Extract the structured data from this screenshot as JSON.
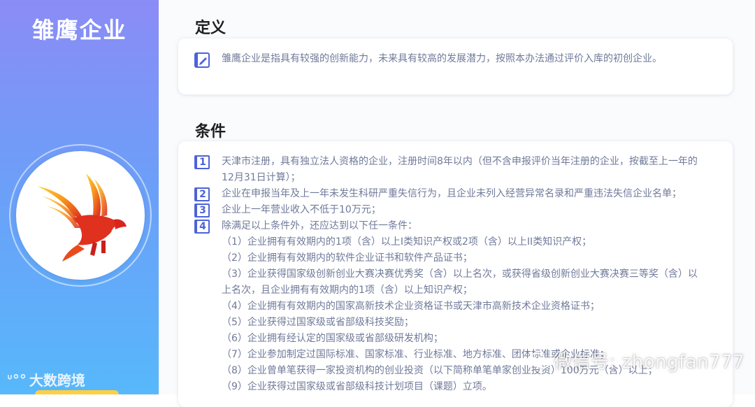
{
  "sidebar": {
    "title": "雏鹰企业",
    "brand_text": "大数跨境",
    "logo_icon": "eagle-logo-icon"
  },
  "definition": {
    "heading": "定义",
    "text": "雏鹰企业是指具有较强的创新能力，未来具有较高的发展潜力，按照本办法通过评价入库的初创企业。"
  },
  "conditions": {
    "heading": "条件",
    "items": [
      {
        "num": "1",
        "lines": [
          "天津市注册，具有独立法人资格的企业，注册时间8年以内（但不含申报评价当年注册的企业，按截至上一年的",
          "12月31日计算）；"
        ]
      },
      {
        "num": "2",
        "lines": [
          "企业在申报当年及上一年未发生科研严重失信行为，且企业未列入经营异常名录和严重违法失信企业名单；"
        ]
      },
      {
        "num": "3",
        "lines": [
          "企业上一年营业收入不低于10万元；"
        ]
      },
      {
        "num": "4",
        "lines": [
          "除满足以上条件外，还应达到以下任一条件："
        ]
      }
    ],
    "sub_items": [
      "（1）企业拥有有效期内的1项（含）以上I类知识产权或2项（含）以上II类知识产权；",
      "（2）企业拥有有效期内的软件企业证书和软件产品证书；",
      "（3）企业获得国家级创新创业大赛决赛优秀奖（含）以上名次，或获得省级创新创业大赛决赛三等奖（含）以",
      "上名次，且企业拥有有效期内的1项（含）以上知识产权；",
      "（4）企业拥有有效期内的国家高新技术企业资格证书或天津市高新技术企业资格证书；",
      "（5）企业获得过国家级或省部级科技奖励；",
      "（6）企业拥有经认定的国家级或省部级研发机构；",
      "（7）企业参加制定过国际标准、国家标准、行业标准、地方标准、团体标准或企业标准；",
      "（8）企业曾单笔获得一家投资机构的创业投资（以下简称单笔单家创业投资）100万元（含）以上；",
      "（9）企业获得过国家级或省部级科技计划项目（课题）立项。"
    ]
  },
  "watermark": {
    "text": "微信号: zhongfan777"
  },
  "colors": {
    "accent": "#4d63d9",
    "body_text": "#707a9a",
    "sidebar_top": "#8b8cf5",
    "sidebar_bottom": "#57b8fb"
  }
}
